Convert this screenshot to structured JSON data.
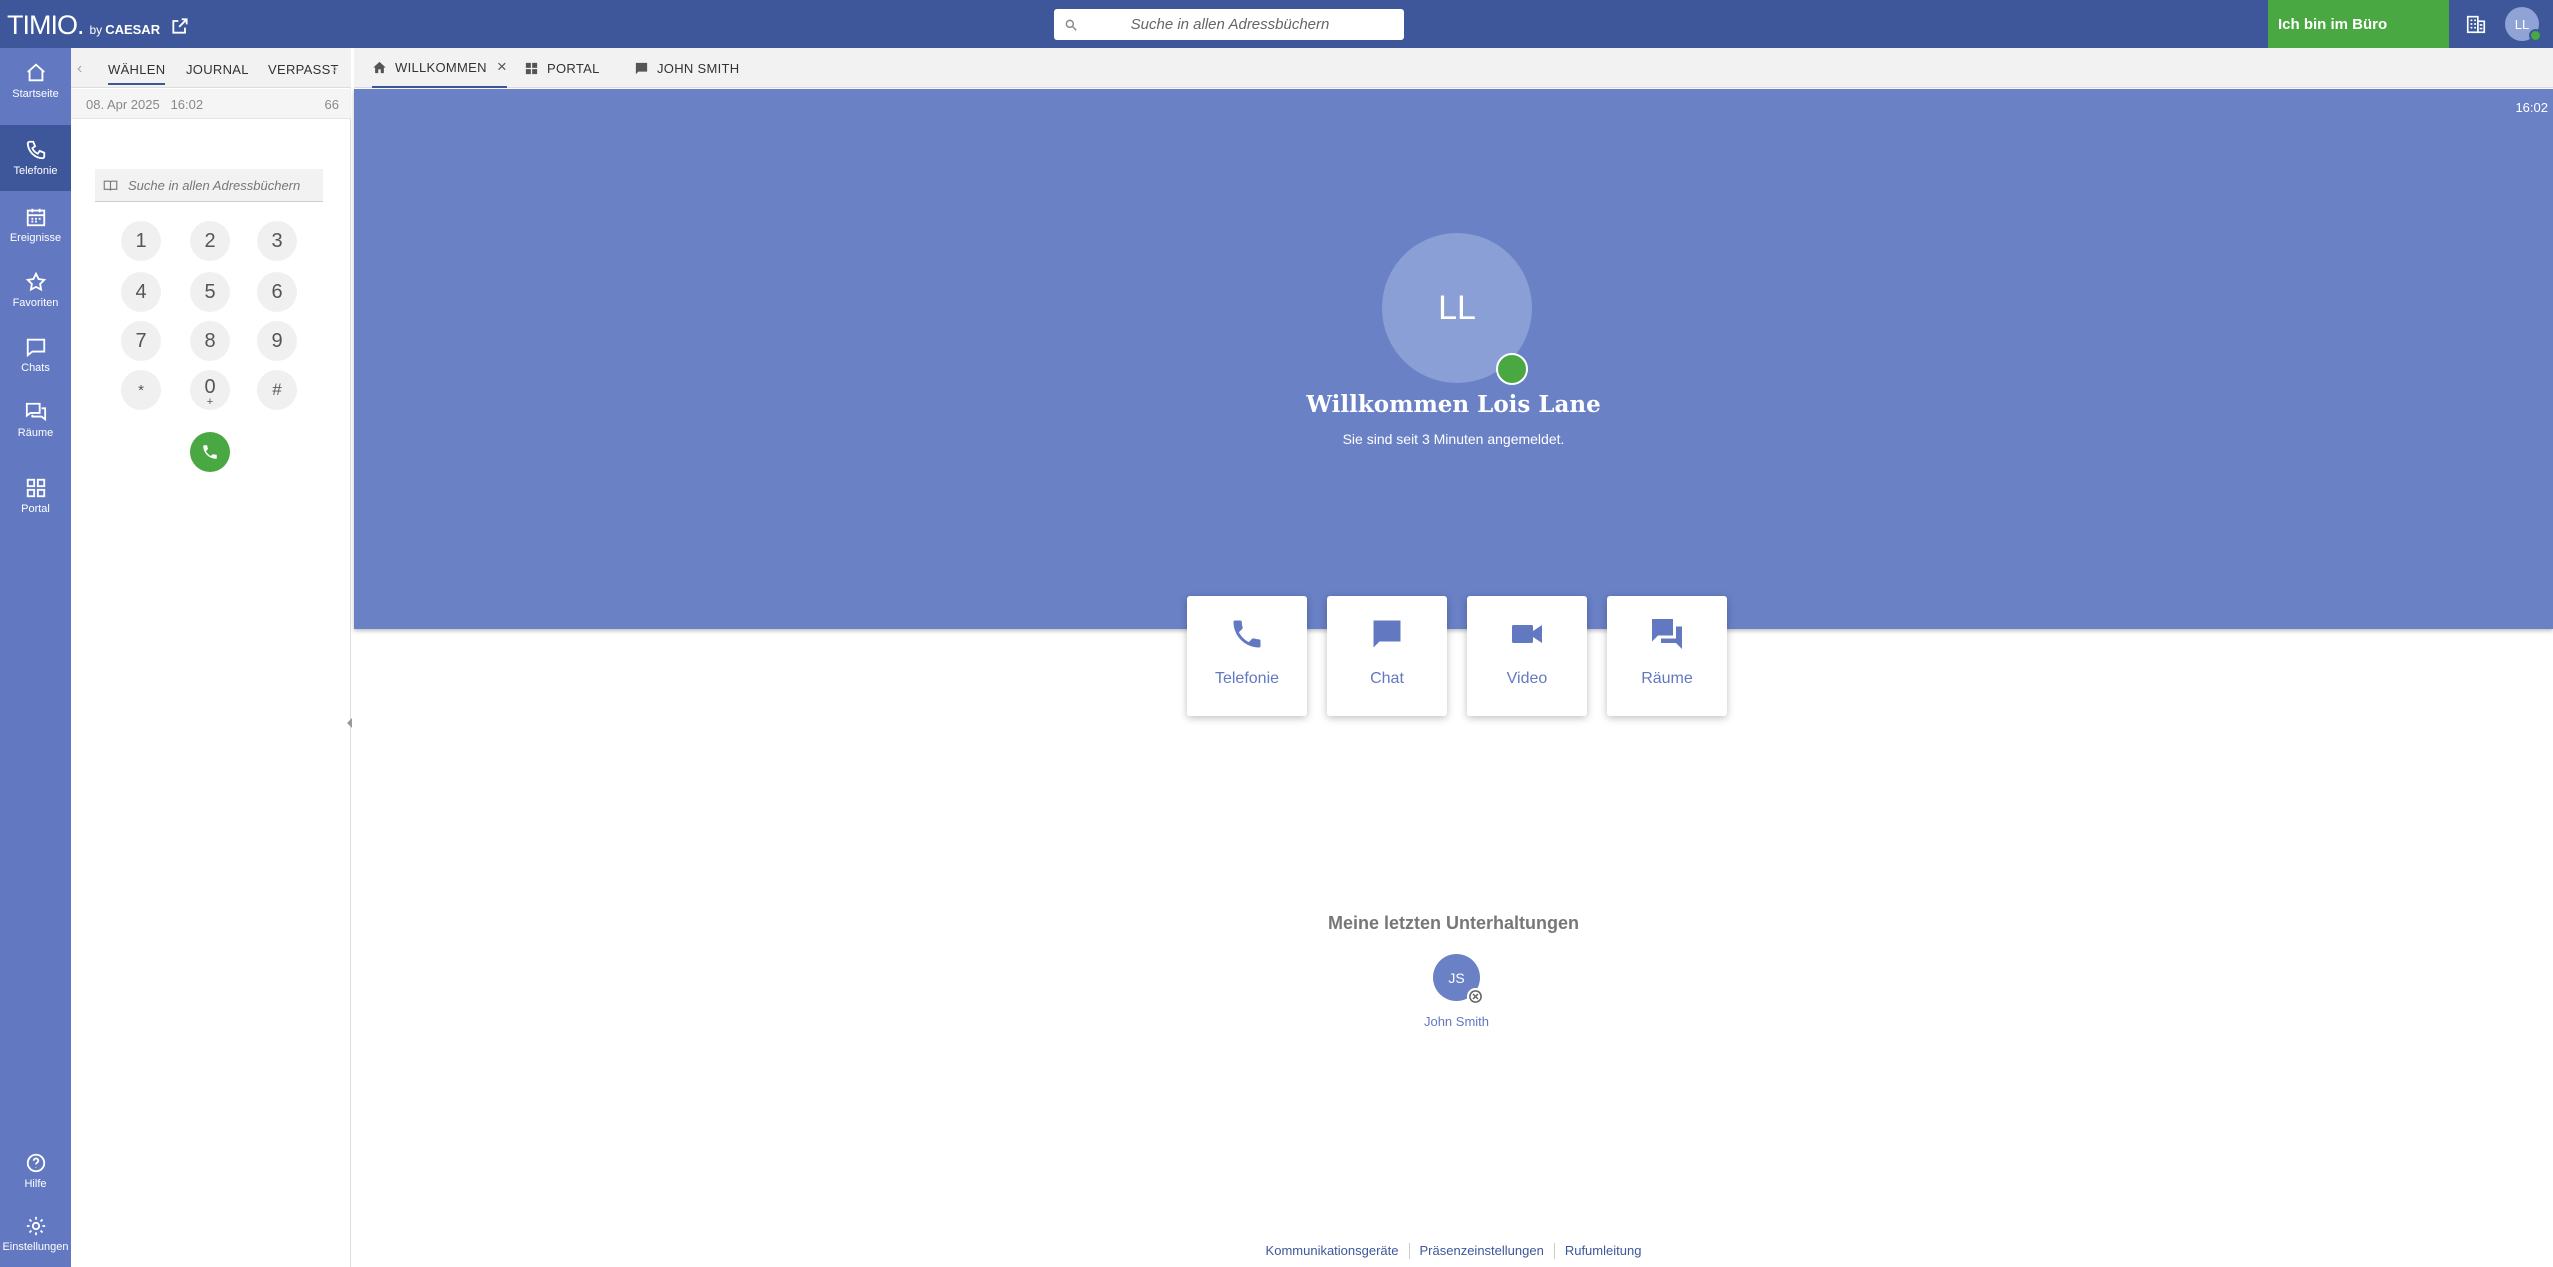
{
  "topbar": {
    "logo_text": "TIMIO.",
    "logo_by": "by",
    "logo_brand": "CAESAR",
    "search_placeholder": "Suche in allen Adressbüchern",
    "presence_label": "Ich bin im Büro",
    "user_initials": "LL"
  },
  "sidebar": {
    "items": [
      {
        "label": "Startseite",
        "icon": "home-icon"
      },
      {
        "label": "Telefonie",
        "icon": "phone-icon"
      },
      {
        "label": "Ereignisse",
        "icon": "calendar-icon"
      },
      {
        "label": "Favoriten",
        "icon": "star-icon"
      },
      {
        "label": "Chats",
        "icon": "chat-icon"
      },
      {
        "label": "Räume",
        "icon": "rooms-icon"
      },
      {
        "label": "Portal",
        "icon": "grid-icon"
      }
    ],
    "bottom": [
      {
        "label": "Hilfe",
        "icon": "help-icon"
      },
      {
        "label": "Einstellungen",
        "icon": "gear-icon"
      }
    ]
  },
  "dialpad": {
    "tabs": [
      "WÄHLEN",
      "JOURNAL",
      "VERPASST"
    ],
    "date": "08. Apr 2025",
    "time": "16:02",
    "count": "66",
    "search_placeholder": "Suche in allen Adressbüchern",
    "keys": [
      "1",
      "2",
      "3",
      "4",
      "5",
      "6",
      "7",
      "8",
      "9",
      "*",
      "0",
      "#"
    ],
    "zero_sub": "+"
  },
  "main_tabs": [
    {
      "label": "WILLKOMMEN",
      "icon": "home-icon"
    },
    {
      "label": "PORTAL",
      "icon": "grid-icon"
    },
    {
      "label": "JOHN SMITH",
      "icon": "chat-icon"
    }
  ],
  "hero": {
    "time": "16:02",
    "initials": "LL",
    "welcome": "Willkommen Lois Lane",
    "subtitle": "Sie sind seit 3 Minuten angemeldet."
  },
  "actions": [
    {
      "label": "Telefonie",
      "icon": "phone-icon"
    },
    {
      "label": "Chat",
      "icon": "chat-icon"
    },
    {
      "label": "Video",
      "icon": "video-icon"
    },
    {
      "label": "Räume",
      "icon": "rooms-icon"
    }
  ],
  "recent": {
    "title": "Meine letzten Unterhaltungen",
    "items": [
      {
        "initials": "JS",
        "name": "John Smith"
      }
    ]
  },
  "footer": [
    "Kommunikationsgeräte",
    "Präsenzeinstellungen",
    "Rufumleitung"
  ],
  "colors": {
    "topbar": "#3d579a",
    "sidebar": "#6279c2",
    "hero": "#6a81c6",
    "presence_green": "#4aa843"
  }
}
